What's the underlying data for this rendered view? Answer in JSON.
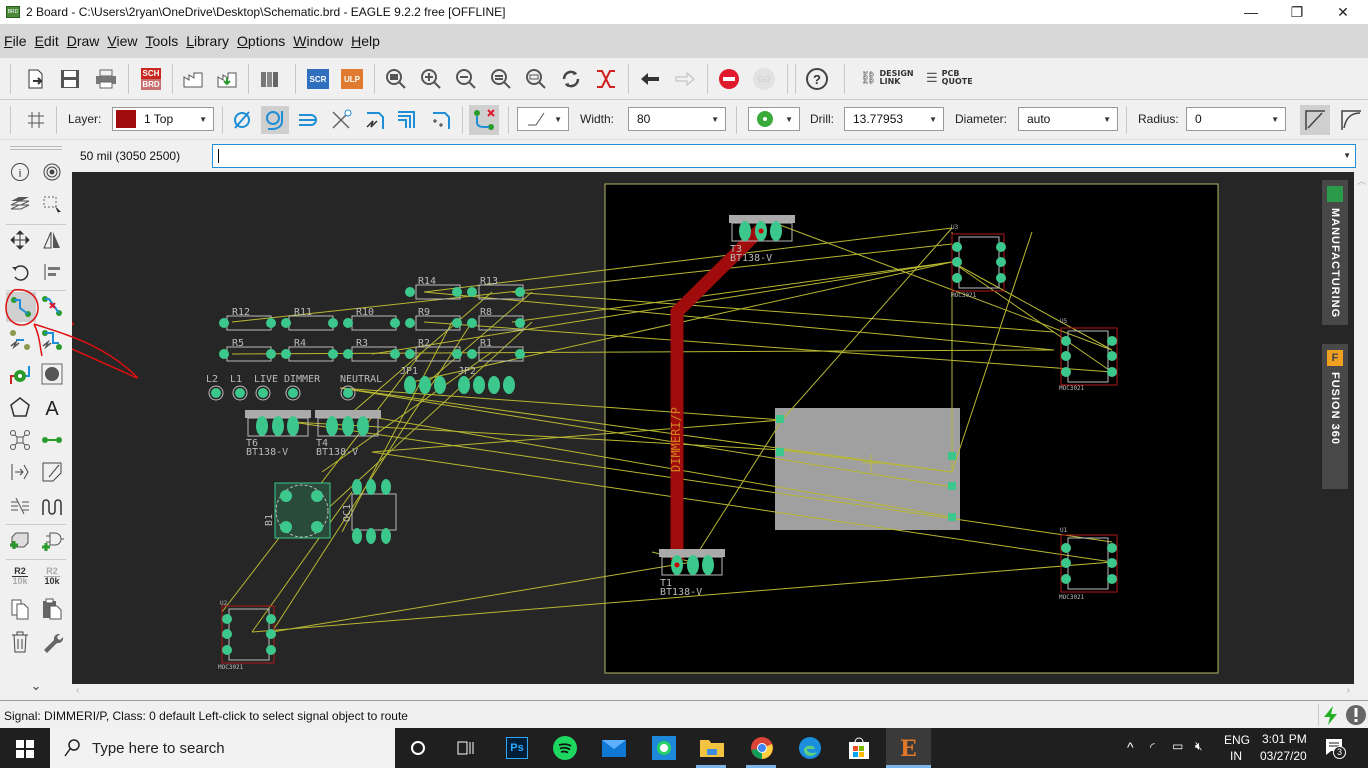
{
  "window": {
    "title": "2 Board - C:\\Users\\2ryan\\OneDrive\\Desktop\\Schematic.brd - EAGLE 9.2.2 free [OFFLINE]",
    "app_icon": "BRD",
    "minimize": "—",
    "restore": "❐",
    "close": "✕"
  },
  "menu": [
    {
      "label": "File",
      "hotkey": "F"
    },
    {
      "label": "Edit",
      "hotkey": "E"
    },
    {
      "label": "Draw",
      "hotkey": "D"
    },
    {
      "label": "View",
      "hotkey": "V"
    },
    {
      "label": "Tools",
      "hotkey": "T"
    },
    {
      "label": "Library",
      "hotkey": "L"
    },
    {
      "label": "Options",
      "hotkey": "O"
    },
    {
      "label": "Window",
      "hotkey": "W"
    },
    {
      "label": "Help",
      "hotkey": "H"
    }
  ],
  "toolbar": {
    "sch_brd_top": "SCH",
    "sch_brd_bottom": "BRD",
    "scr": "SCR",
    "ulp": "ULP",
    "go": "GO",
    "help": "?",
    "design_link": "DESIGN\nLINK",
    "design_link_1": "DESIGN",
    "design_link_2": "LINK",
    "pcb_quote_1": "PCB",
    "pcb_quote_2": "QUOTE"
  },
  "params": {
    "layer_label": "Layer:",
    "layer_value": "1 Top",
    "layer_color": "#a00c0c",
    "width_label": "Width:",
    "width_value": "80",
    "drill_label": "Drill:",
    "drill_value": "13.77953",
    "diameter_label": "Diameter:",
    "diameter_value": "auto",
    "radius_label": "Radius:",
    "radius_value": "0"
  },
  "command": {
    "coordinates": "50 mil (3050 2500)",
    "input_value": ""
  },
  "sidebar": {
    "value_top": "R2",
    "value_bottom": "10k"
  },
  "board": {
    "signal_label": "DIMMERI/P",
    "parts": [
      {
        "name": "R14"
      },
      {
        "name": "R13"
      },
      {
        "name": "R12"
      },
      {
        "name": "R11"
      },
      {
        "name": "R10"
      },
      {
        "name": "R9"
      },
      {
        "name": "R8"
      },
      {
        "name": "R5"
      },
      {
        "name": "R4"
      },
      {
        "name": "R3"
      },
      {
        "name": "R2"
      },
      {
        "name": "R1"
      },
      {
        "name": "L2"
      },
      {
        "name": "L1"
      },
      {
        "name": "LIVE"
      },
      {
        "name": "DIMMER"
      },
      {
        "name": "NEUTRAL"
      },
      {
        "name": "JP1"
      },
      {
        "name": "JP2"
      },
      {
        "name": "T6",
        "value": "BT138-V"
      },
      {
        "name": "T4",
        "value": "BT138-V"
      },
      {
        "name": "T3",
        "value": "BT138-V"
      },
      {
        "name": "T1",
        "value": "BT138-V"
      },
      {
        "name": "B1"
      },
      {
        "name": "OC1"
      },
      {
        "name": "U2",
        "value": "MOC3021"
      },
      {
        "name": "U3",
        "value": "MOC3021"
      },
      {
        "name": "U5",
        "value": "MOC3021"
      },
      {
        "name": "U1",
        "value": "MOC3021"
      }
    ]
  },
  "side_panels": {
    "manufacturing": "MANUFACTURING",
    "fusion": "FUSION 360"
  },
  "status": {
    "text": "Signal: DIMMERI/P, Class: 0 default Left-click to select signal object to route"
  },
  "taskbar": {
    "search_placeholder": "Type here to search",
    "lang_1": "ENG",
    "lang_2": "IN",
    "time": "3:01 PM",
    "date": "03/27/20",
    "notifications": "3",
    "ps_label": "Ps"
  }
}
